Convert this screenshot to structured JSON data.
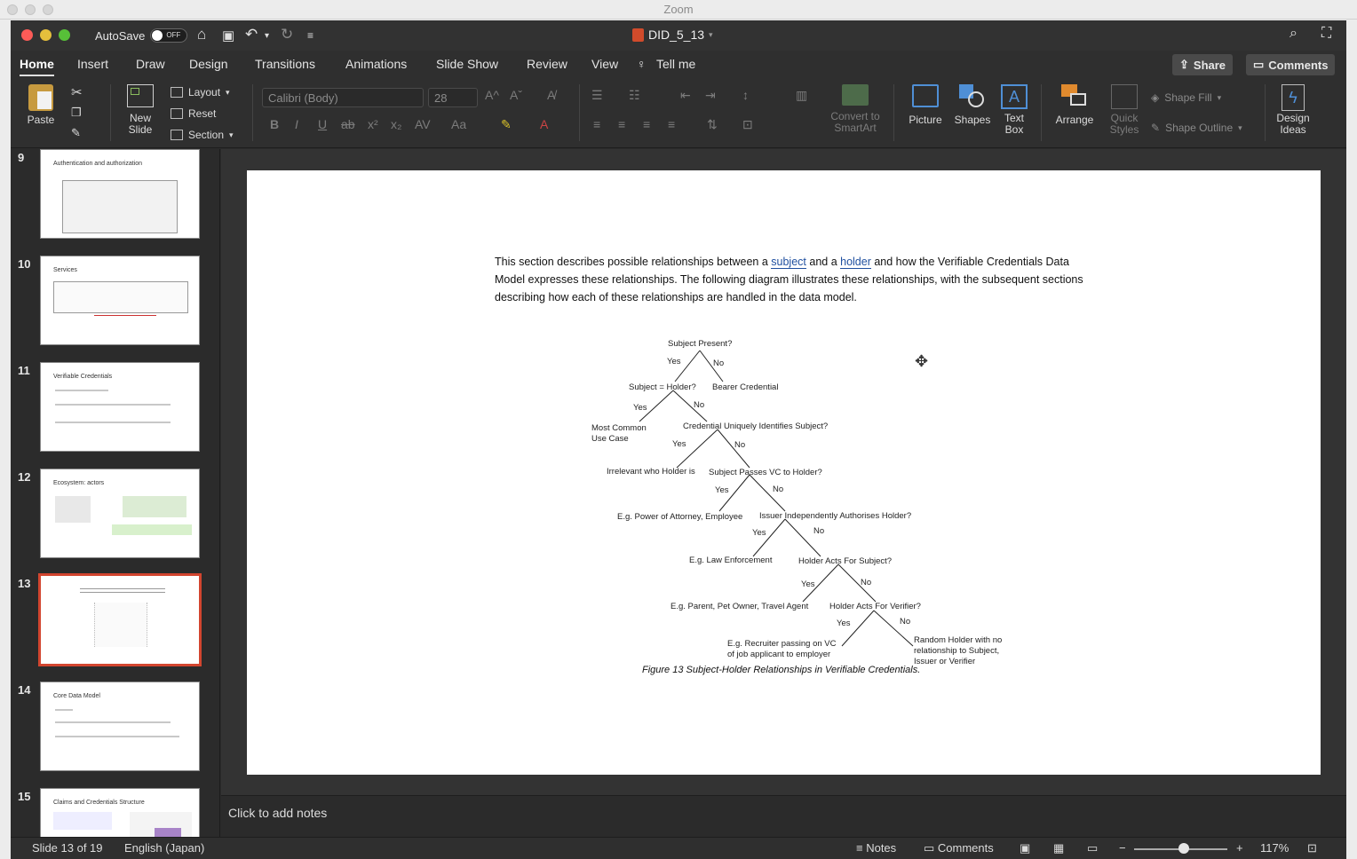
{
  "zoom_window": {
    "title": "Zoom"
  },
  "titlebar": {
    "autosave_label": "AutoSave",
    "autosave_state": "OFF",
    "document_title": "DID_5_13"
  },
  "tabs": [
    "Home",
    "Insert",
    "Draw",
    "Design",
    "Transitions",
    "Animations",
    "Slide Show",
    "Review",
    "View"
  ],
  "tell_me": "Tell me",
  "share_label": "Share",
  "comments_label": "Comments",
  "ribbon": {
    "paste": "Paste",
    "new_slide_1": "New",
    "new_slide_2": "Slide",
    "layout": "Layout",
    "reset": "Reset",
    "section": "Section",
    "font_name": "Calibri (Body)",
    "font_size": "28",
    "convert_1": "Convert to",
    "convert_2": "SmartArt",
    "picture": "Picture",
    "shapes": "Shapes",
    "textbox_1": "Text",
    "textbox_2": "Box",
    "arrange": "Arrange",
    "quick_1": "Quick",
    "quick_2": "Styles",
    "shape_fill": "Shape Fill",
    "shape_outline": "Shape Outline",
    "design_1": "Design",
    "design_2": "Ideas"
  },
  "thumbnails": [
    {
      "num": "9",
      "title": "Authentication and authorization"
    },
    {
      "num": "10",
      "title": "Services"
    },
    {
      "num": "11",
      "title": "Verifiable Credentials"
    },
    {
      "num": "12",
      "title": "Ecosystem: actors"
    },
    {
      "num": "13",
      "title": ""
    },
    {
      "num": "14",
      "title": "Core Data Model"
    },
    {
      "num": "15",
      "title": "Claims and Credentials Structure"
    }
  ],
  "slide": {
    "para_a": "This section describes possible relationships between a ",
    "link_subject": "subject",
    "para_b": " and a ",
    "link_holder": "holder",
    "para_c": " and how the Verifiable Credentials Data Model expresses these relationships. The following diagram illustrates these relationships, with the subsequent sections describing how each of these relationships are handled in the data model.",
    "tree": {
      "n1": "Subject Present?",
      "n2": "Subject = Holder?",
      "n3": "Bearer Credential",
      "n4a": "Most Common",
      "n4b": "Use Case",
      "n5": "Credential Uniquely Identifies Subject?",
      "n6": "Irrelevant who Holder is",
      "n7": "Subject Passes VC to Holder?",
      "n8": "E.g. Power of Attorney, Employee",
      "n9": "Issuer Independently Authorises Holder?",
      "n10": "E.g. Law Enforcement",
      "n11": "Holder Acts For Subject?",
      "n12": "E.g. Parent, Pet Owner, Travel Agent",
      "n13": "Holder Acts For Verifier?",
      "n14a": "E.g. Recruiter passing on VC",
      "n14b": "of job applicant to employer",
      "n15a": "Random Holder with no",
      "n15b": "relationship to Subject,",
      "n15c": "Issuer or Verifier",
      "yes": "Yes",
      "no": "No"
    },
    "caption": "Figure 13 Subject-Holder Relationships in Verifiable Credentials."
  },
  "notes_placeholder": "Click to add notes",
  "status": {
    "slide_info": "Slide 13 of 19",
    "language": "English (Japan)",
    "notes": "Notes",
    "comments": "Comments",
    "zoom": "117%"
  }
}
